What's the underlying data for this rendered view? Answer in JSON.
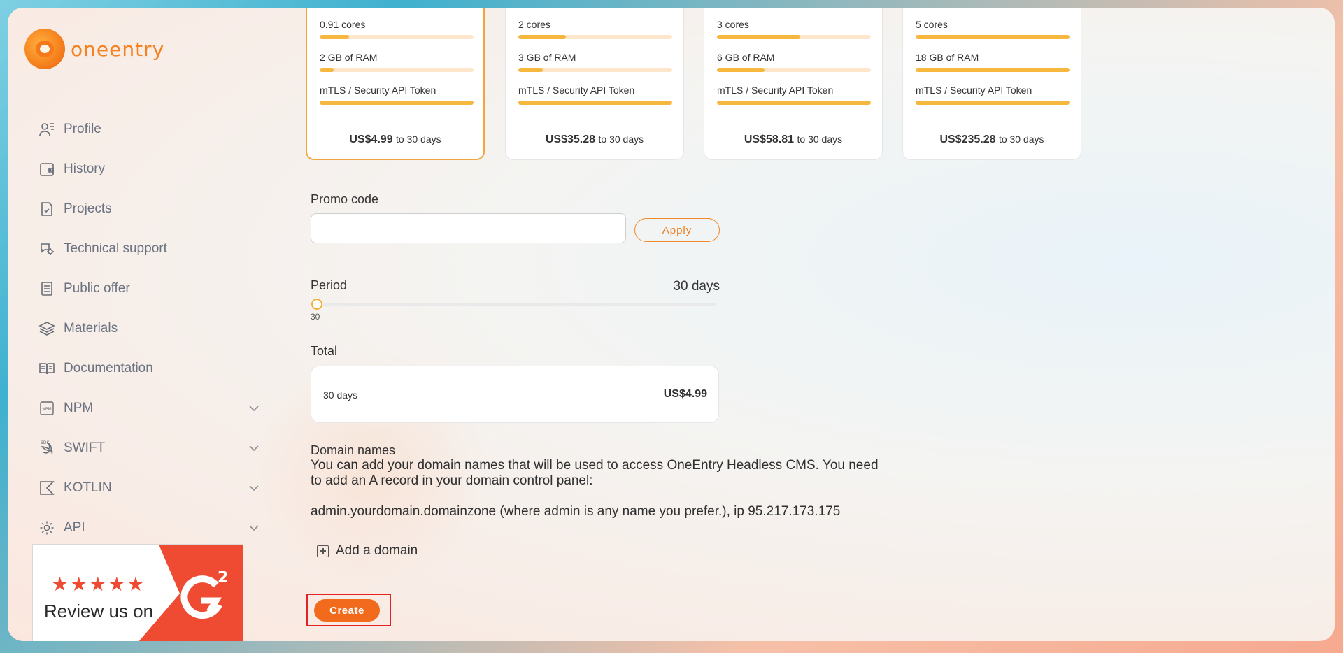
{
  "brand": {
    "name": "oneentry"
  },
  "sidebar": {
    "items": [
      {
        "label": "Profile",
        "icon": "user-list-icon",
        "expandable": false
      },
      {
        "label": "History",
        "icon": "wallet-icon",
        "expandable": false
      },
      {
        "label": "Projects",
        "icon": "document-check-icon",
        "expandable": false
      },
      {
        "label": "Technical support",
        "icon": "support-gear-icon",
        "expandable": false
      },
      {
        "label": "Public offer",
        "icon": "document-lines-icon",
        "expandable": false
      },
      {
        "label": "Materials",
        "icon": "layers-icon",
        "expandable": false
      },
      {
        "label": "Documentation",
        "icon": "book-icon",
        "expandable": false
      },
      {
        "label": "NPM",
        "icon": "npm-icon",
        "expandable": true
      },
      {
        "label": "SWIFT",
        "icon": "swift-icon",
        "expandable": true
      },
      {
        "label": "KOTLIN",
        "icon": "kotlin-icon",
        "expandable": true
      },
      {
        "label": "API",
        "icon": "gear-icon",
        "expandable": true
      }
    ],
    "g2_badge": {
      "stars": "★★★★★",
      "text": "Review us on",
      "logo": "G2"
    }
  },
  "plans": [
    {
      "cores": "0.91 cores",
      "ram": "2 GB of RAM",
      "token": "mTLS / Security API Token",
      "price": "US$4.99",
      "per": "to 30 days",
      "cores_fill": 0.19,
      "ram_fill": 0.09,
      "token_fill": 1.0,
      "selected": true
    },
    {
      "cores": "2 cores",
      "ram": "3 GB of RAM",
      "token": "mTLS / Security API Token",
      "price": "US$35.28",
      "per": "to 30 days",
      "cores_fill": 0.31,
      "ram_fill": 0.16,
      "token_fill": 1.0,
      "selected": false
    },
    {
      "cores": "3 cores",
      "ram": "6 GB of RAM",
      "token": "mTLS / Security API Token",
      "price": "US$58.81",
      "per": "to 30 days",
      "cores_fill": 0.54,
      "ram_fill": 0.31,
      "token_fill": 1.0,
      "selected": false
    },
    {
      "cores": "5 cores",
      "ram": "18 GB of RAM",
      "token": "mTLS / Security API Token",
      "price": "US$235.28",
      "per": "to 30 days",
      "cores_fill": 1.0,
      "ram_fill": 1.0,
      "token_fill": 1.0,
      "selected": false
    }
  ],
  "promo": {
    "label": "Promo code",
    "value": "",
    "placeholder": "",
    "apply_label": "Apply"
  },
  "period": {
    "label": "Period",
    "value_label": "30 days",
    "tick": "30",
    "slider_fraction": 0
  },
  "total": {
    "label": "Total",
    "duration": "30 days",
    "amount": "US$4.99"
  },
  "domains": {
    "label": "Domain names",
    "description": "You can add your domain names that will be used to access OneEntry Headless CMS. You need to add an A record in your domain control panel:",
    "example": "admin.yourdomain.domainzone (where admin is any name you prefer.), ip 95.217.173.175",
    "add_label": "Add a domain"
  },
  "create_label": "Create",
  "colors": {
    "accent": "#f26a1c",
    "bar": "#f5b73d",
    "bar_bg": "#fde6cb",
    "highlight": "#e52222"
  }
}
